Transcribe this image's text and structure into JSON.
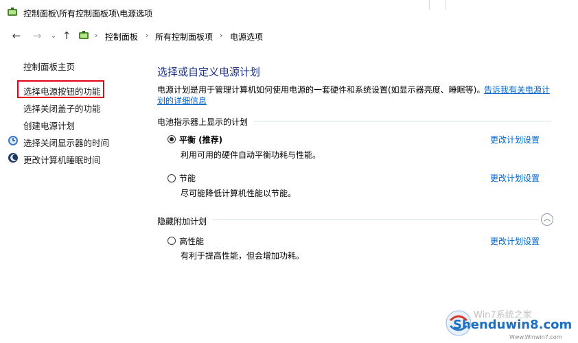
{
  "window": {
    "title": "控制面板\\所有控制面板项\\电源选项"
  },
  "nav": {
    "back": "←",
    "forward": "→",
    "recent": "⌄",
    "up": "↑",
    "breadcrumb": [
      "控制面板",
      "所有控制面板项",
      "电源选项"
    ],
    "separator": "›"
  },
  "left_pane": {
    "home": "控制面板主页",
    "links": [
      "选择电源按钮的功能",
      "选择关闭盖子的功能",
      "创建电源计划",
      "选择关闭显示器的时间",
      "更改计算机睡眠时间"
    ]
  },
  "main": {
    "title": "选择或自定义电源计划",
    "description": "电源计划是用于管理计算机如何使用电源的一套硬件和系统设置(如显示器亮度、睡眠等)。",
    "learn_more_line1": "告诉我有关电源计",
    "learn_more_line2": "划的详细信息",
    "battery_section": "电池指示器上显示的计划",
    "hidden_section": "隐藏附加计划",
    "plans": [
      {
        "name": "平衡 (推荐)",
        "desc": "利用可用的硬件自动平衡功耗与性能。",
        "link": "更改计划设置",
        "selected": true
      },
      {
        "name": "节能",
        "desc": "尽可能降低计算机性能以节能。",
        "link": "更改计划设置",
        "selected": false
      },
      {
        "name": "高性能",
        "desc": "有利于提高性能，但会增加功耗。",
        "link": "更改计划设置",
        "selected": false
      }
    ],
    "collapse": "︿"
  },
  "watermark": {
    "text": "Shenduwin8.com",
    "sub": "Win7系统之家",
    "url": "Www.Winwin7.com"
  },
  "colors": {
    "title_blue": "#1e3287",
    "link_blue": "#0066cc",
    "highlight_red": "#e60012"
  }
}
